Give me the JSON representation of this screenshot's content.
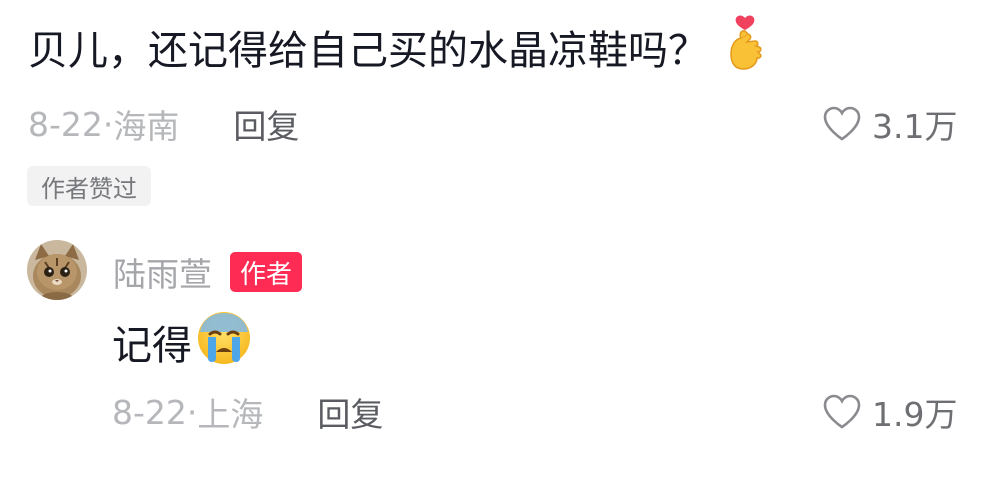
{
  "comment": {
    "text": "贝儿，还记得给自己买的水晶凉鞋吗？",
    "emoji": "finger-heart-emoji",
    "date": "8-22",
    "location": "海南",
    "reply_label": "回复",
    "likes": "3.1万",
    "liked_by_author": "作者赞过"
  },
  "reply": {
    "author": "陆雨萱",
    "author_badge": "作者",
    "text": "记得",
    "emoji": "crying-face-emoji",
    "date": "8-22",
    "location": "上海",
    "reply_label": "回复",
    "likes": "1.9万"
  },
  "colors": {
    "text": "#161823",
    "meta": "#b6b7ba",
    "badge_red": "#fe2c55"
  }
}
